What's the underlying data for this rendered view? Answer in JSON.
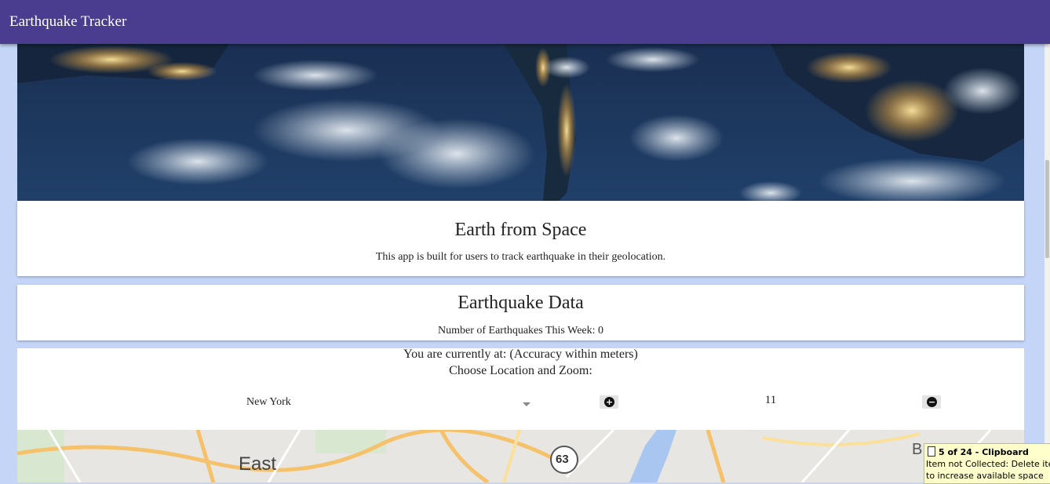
{
  "appbar": {
    "title": "Earthquake Tracker"
  },
  "hero_card": {
    "image_alt": "Earth at night from space",
    "heading": "Earth from Space",
    "description": "This app is built for users to track earthquake in their geolocation."
  },
  "data_card": {
    "heading": "Earthquake Data",
    "count_text": "Number of Earthquakes This Week: 0"
  },
  "location_card": {
    "current_location": "You are currently at: (Accuracy within meters)",
    "choose_label": "Choose Location and Zoom:",
    "location_select": {
      "value": "New York"
    },
    "zoom_value": "11",
    "zoom_in_icon": "plus-circle-icon",
    "zoom_out_icon": "minus-circle-icon"
  },
  "map": {
    "labels": [
      "East",
      "63",
      "B"
    ]
  },
  "clipboard_tooltip": {
    "title": "5 of 24 - Clipboard",
    "line1": "Item not Collected: Delete items",
    "line2": "to increase available space"
  },
  "colors": {
    "appbar": "#4a3c8e",
    "page_background": "#c5d5f7",
    "card": "#ffffff",
    "tooltip": "#ffffcc"
  }
}
